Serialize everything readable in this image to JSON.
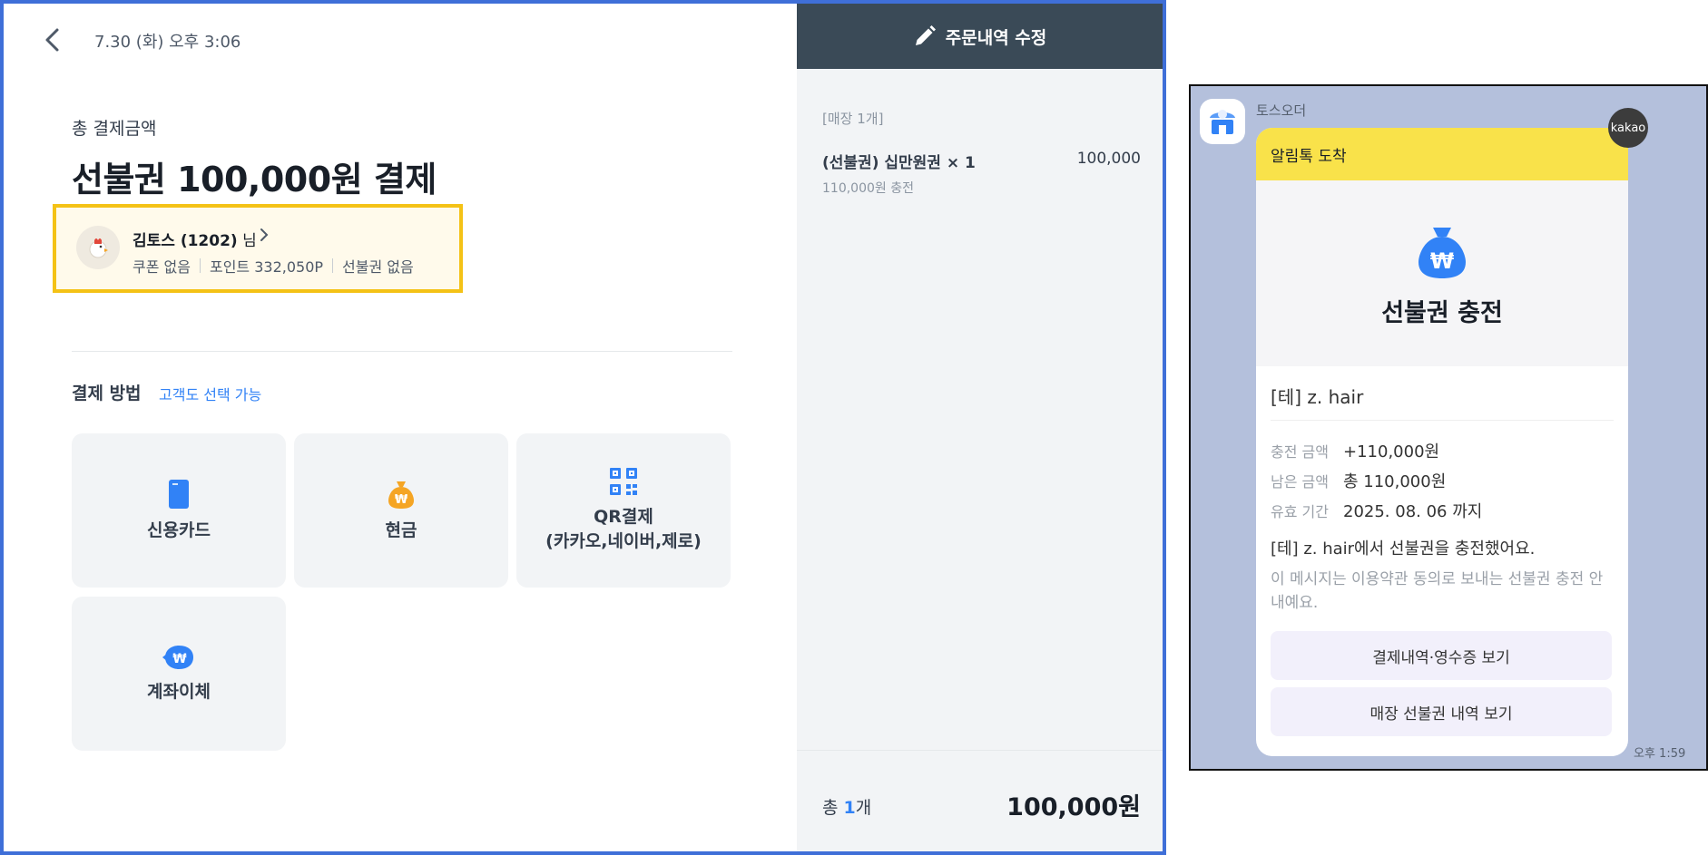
{
  "pos": {
    "datetime": "7.30 (화) 오후 3:06",
    "total_label": "총 결제금액",
    "total_title": "선불권 100,000원 결제",
    "customer": {
      "name": "김토스 (1202)",
      "suffix": " 님",
      "coupon": "쿠폰 없음",
      "points": "포인트 332,050P",
      "prepaid": "선불권 없음"
    },
    "payment_method_label": "결제 방법",
    "payment_method_sub": "고객도 선택 가능",
    "methods": [
      {
        "label": "신용카드",
        "icon": "credit-card-icon",
        "color": "#3182f6"
      },
      {
        "label": "현금",
        "icon": "money-bag-icon",
        "color": "#f5a524"
      },
      {
        "label": "QR결제",
        "label2": "(카카오,네이버,제로)",
        "icon": "qr-code-icon",
        "color": "#3182f6"
      },
      {
        "label": "계좌이체",
        "icon": "bank-transfer-icon",
        "color": "#3182f6"
      }
    ]
  },
  "order": {
    "edit_label": "주문내역 수정",
    "store_tag": "[매장 1개]",
    "item_name": "(선불권) 십만원권 × 1",
    "item_price": "100,000",
    "item_sub": "110,000원 충전",
    "sum_prefix": "총 ",
    "sum_count": "1",
    "sum_suffix": "개",
    "sum_total": "100,000원"
  },
  "kakao": {
    "sender": "토스오더",
    "header": "알림톡 도착",
    "title": "선불권 충전",
    "shop": "[테] z. hair",
    "rows": [
      {
        "key": "충전 금액",
        "value": "+110,000원"
      },
      {
        "key": "남은 금액",
        "value": "총 110,000원"
      },
      {
        "key": "유효 기간",
        "value": "2025. 08. 06 까지"
      }
    ],
    "message": "[테] z. hair에서 선불권을 충전했어요.",
    "note": "이 메시지는 이용약관 동의로 보내는 선불권 충전 안내예요.",
    "btn1": "결제내역·영수증 보기",
    "btn2": "매장 선불권 내역 보기",
    "badge": "kakao",
    "time": "오후 1:59"
  },
  "colors": {
    "accent": "#3182f6",
    "frame": "#3f6fd8",
    "highlight": "#f4c216",
    "header_dark": "#3a4a57",
    "kakao_yellow": "#f9e24a"
  }
}
